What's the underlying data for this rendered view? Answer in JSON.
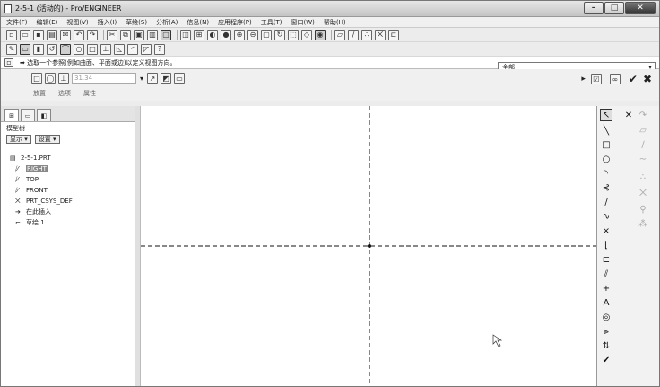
{
  "window": {
    "title": "2-5-1 (活动的) - Pro/ENGINEER",
    "min": "–",
    "max": "□",
    "close": "✕"
  },
  "menu": [
    "文件(F)",
    "编辑(E)",
    "视图(V)",
    "插入(I)",
    "草绘(S)",
    "分析(A)",
    "信息(N)",
    "应用程序(P)",
    "工具(T)",
    "窗口(W)",
    "帮助(H)"
  ],
  "message": {
    "text": "➡ 选取一个参照(例如曲面、平面或边)以定义视图方向。"
  },
  "filter": {
    "value": "全部"
  },
  "dashboard": {
    "value": "31.34",
    "tabs": [
      "放置",
      "选项",
      "属性"
    ]
  },
  "model_tree": {
    "header": "模型树",
    "show_btn": "显示 ▾",
    "settings_btn": "设置 ▾",
    "items": [
      {
        "label": "2-5-1.PRT",
        "glyph": "▤"
      },
      {
        "label": "RIGHT",
        "glyph": "⧸⁄"
      },
      {
        "label": "TOP",
        "glyph": "⧸⁄"
      },
      {
        "label": "FRONT",
        "glyph": "⧸⁄"
      },
      {
        "label": "PRT_CSYS_DEF",
        "glyph": "⨉"
      },
      {
        "label": "在此插入",
        "glyph": "➔"
      },
      {
        "label": "草绘 1",
        "glyph": "⌐"
      }
    ]
  },
  "colors": {
    "canvas": "#ffffff",
    "frame": "#ececec"
  }
}
